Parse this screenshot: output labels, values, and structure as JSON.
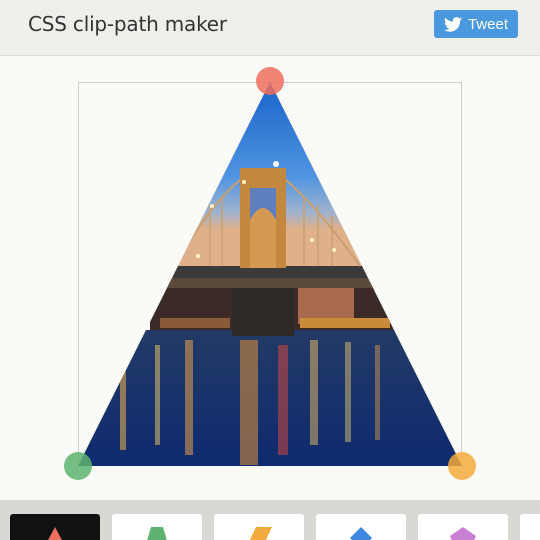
{
  "header": {
    "title": "CSS clip-path maker",
    "tweet_label": "Tweet",
    "tweet_icon": "twitter-bird-icon"
  },
  "editor": {
    "image_subject": "city-bridge-night-photo",
    "handles": [
      {
        "name": "top-handle",
        "color": "#ee6f5e"
      },
      {
        "name": "bottom-left-handle",
        "color": "#5db36f"
      },
      {
        "name": "bottom-right-handle",
        "color": "#f4aa3c"
      }
    ]
  },
  "shape_gallery": {
    "tiles": [
      {
        "name": "triangle",
        "color": "#ee6f5e",
        "selected": true
      },
      {
        "name": "trapezoid",
        "color": "#5db36f",
        "selected": false
      },
      {
        "name": "parallelogram",
        "color": "#f4aa3c",
        "selected": false
      },
      {
        "name": "rhombus",
        "color": "#3f86e0",
        "selected": false
      },
      {
        "name": "pentagon",
        "color": "#c97fd4",
        "selected": false
      }
    ]
  }
}
